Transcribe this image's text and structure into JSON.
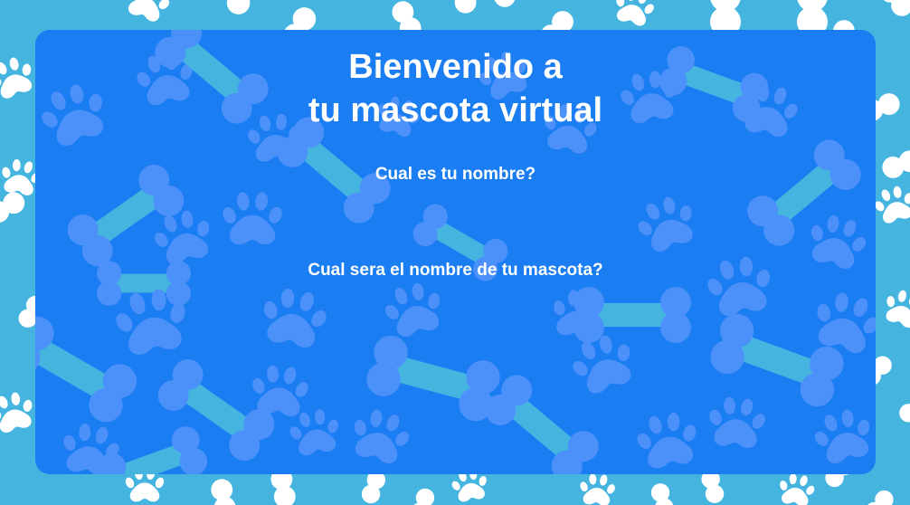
{
  "colors": {
    "background": "#45b5e0",
    "background_motif": "#ffffff",
    "panel": "#1a7df2",
    "panel_motif": "#4c90fa",
    "text": "#ffffff"
  },
  "background": {
    "pattern_icons": [
      "bone-icon",
      "paw-print-icon"
    ]
  },
  "welcome": {
    "title_line_1": "Bienvenido a",
    "title_line_2": "tu mascota virtual"
  },
  "form": {
    "name_question": "Cual es tu nombre?",
    "name_value": "",
    "pet_question": "Cual sera el nombre de tu mascota?",
    "pet_value": ""
  }
}
